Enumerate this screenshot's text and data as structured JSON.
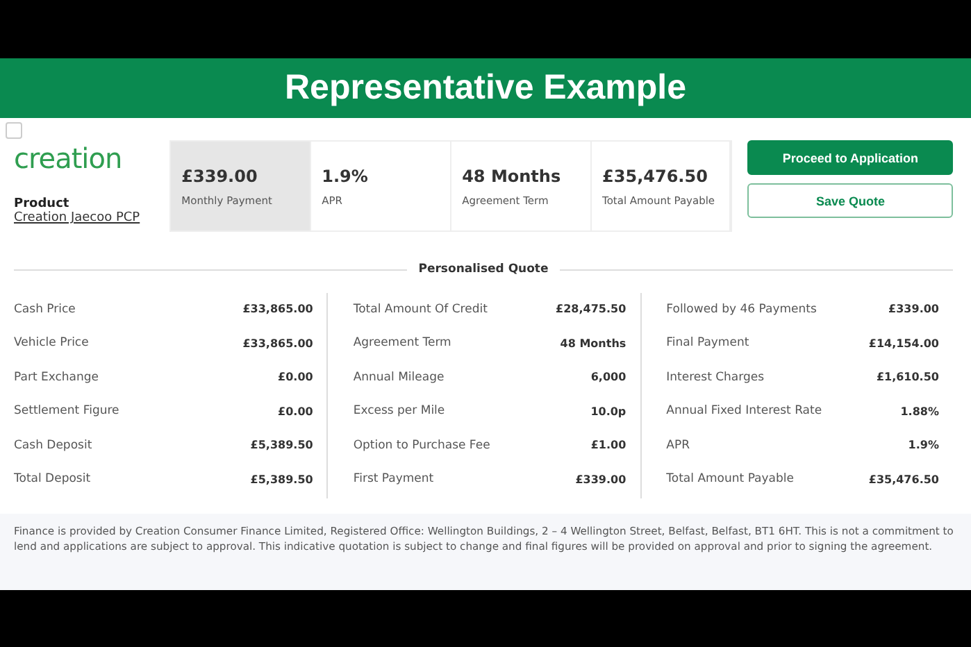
{
  "banner": {
    "title": "Representative Example"
  },
  "checkbox": {
    "checked": false
  },
  "brand": {
    "logo": "creation",
    "product_label": "Product",
    "product_name": "Creation Jaecoo PCP"
  },
  "summary": [
    {
      "value": "£339.00",
      "label": "Monthly Payment",
      "selected": true
    },
    {
      "value": "1.9%",
      "label": "APR",
      "selected": false
    },
    {
      "value": "48 Months",
      "label": "Agreement Term",
      "selected": false
    },
    {
      "value": "£35,476.50",
      "label": "Total Amount Payable",
      "selected": false
    }
  ],
  "buttons": [
    {
      "label": "Proceed to Application",
      "kind": "primary"
    },
    {
      "label": "Save Quote",
      "kind": "secondary"
    }
  ],
  "quote": {
    "title": "Personalised Quote",
    "columns": [
      [
        {
          "label": "Cash Price",
          "value": "£33,865.00"
        },
        {
          "label": "Vehicle Price",
          "value": "£33,865.00"
        },
        {
          "label": "Part Exchange",
          "value": "£0.00"
        },
        {
          "label": "Settlement Figure",
          "value": "£0.00"
        },
        {
          "label": "Cash Deposit",
          "value": "£5,389.50"
        },
        {
          "label": "Total Deposit",
          "value": "£5,389.50"
        }
      ],
      [
        {
          "label": "Total Amount Of Credit",
          "value": "£28,475.50"
        },
        {
          "label": "Agreement Term",
          "value": "48 Months"
        },
        {
          "label": "Annual Mileage",
          "value": "6,000"
        },
        {
          "label": "Excess per Mile",
          "value": "10.0p"
        },
        {
          "label": "Option to Purchase Fee",
          "value": "£1.00"
        },
        {
          "label": "First Payment",
          "value": "£339.00"
        }
      ],
      [
        {
          "label": "Followed by 46 Payments",
          "value": "£339.00"
        },
        {
          "label": "Final Payment",
          "value": "£14,154.00"
        },
        {
          "label": "Interest Charges",
          "value": "£1,610.50"
        },
        {
          "label": "Annual Fixed Interest Rate",
          "value": "1.88%"
        },
        {
          "label": "APR",
          "value": "1.9%"
        },
        {
          "label": "Total Amount Payable",
          "value": "£35,476.50"
        }
      ]
    ]
  },
  "disclaimer": "Finance is provided by Creation Consumer Finance Limited, Registered Office: Wellington Buildings, 2 – 4 Wellington Street, Belfast, Belfast, BT1 6HT. This is not a commitment to lend and applications are subject to approval. This indicative quotation is subject to change and final figures will be provided on approval and prior to signing the agreement."
}
